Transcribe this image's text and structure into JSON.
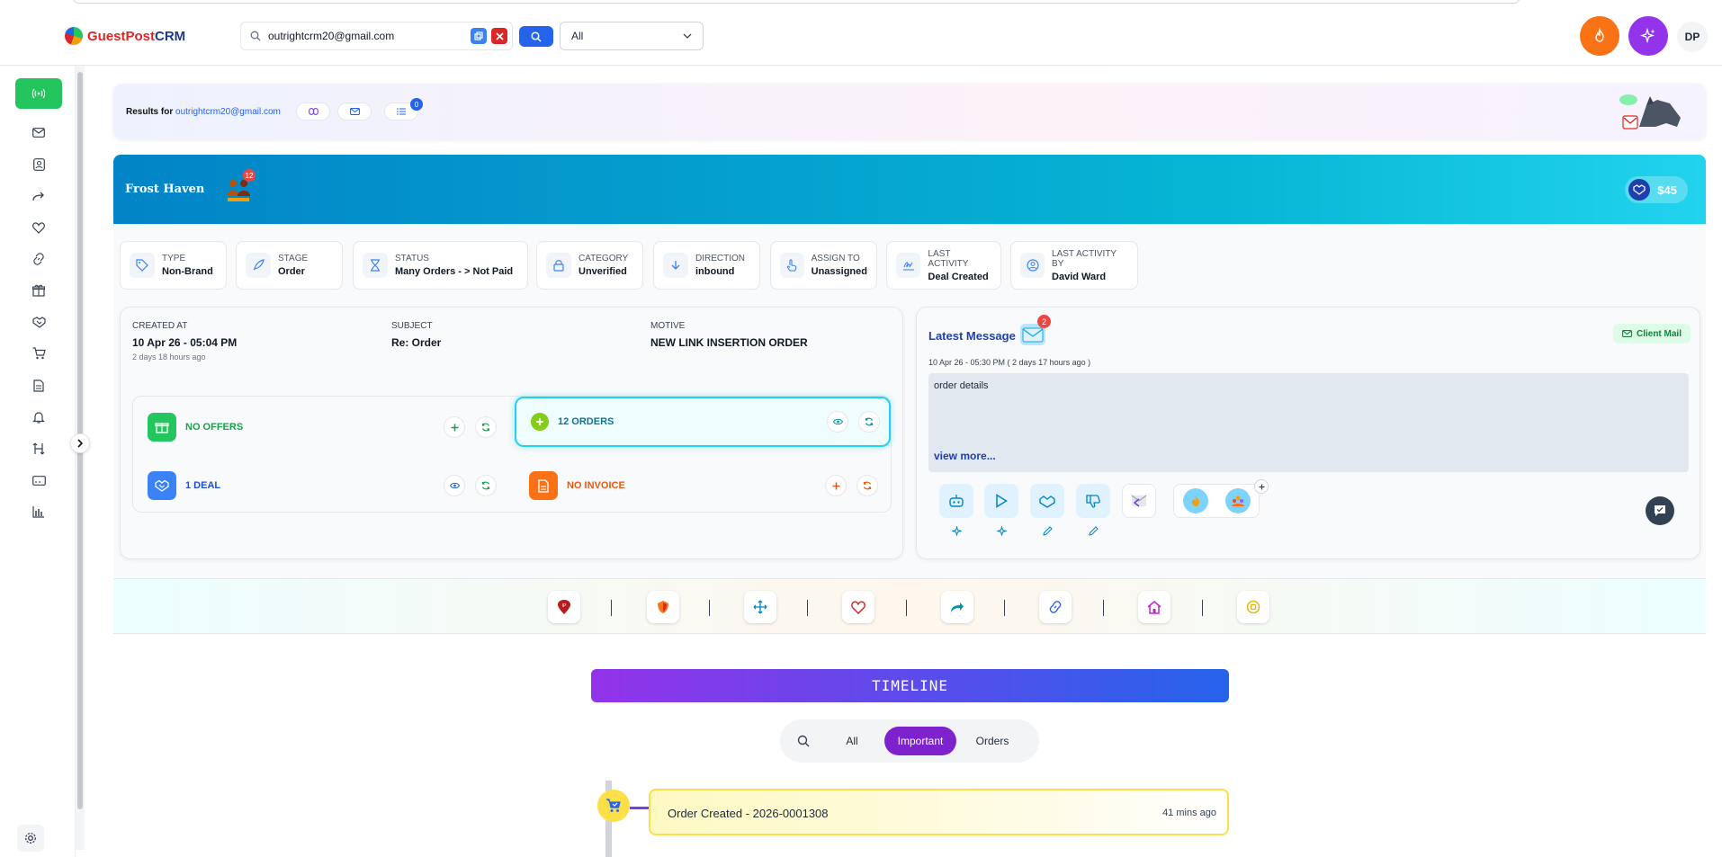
{
  "brand": {
    "part1": "GuestPost",
    "part2": "CRM"
  },
  "search": {
    "value": "outrightcrm20@gmail.com",
    "filter": "All"
  },
  "user": {
    "initials": "DP"
  },
  "results": {
    "prefix": "Results for",
    "email": "outrightcrm20@gmail.com",
    "list_badge": "0"
  },
  "deal": {
    "title": "Frost Haven",
    "people_count": "12",
    "amount": "$45"
  },
  "info": [
    {
      "key": "TYPE",
      "value": "Non-Brand",
      "icon": "tag-icon"
    },
    {
      "key": "STAGE",
      "value": "Order",
      "icon": "rocket-icon"
    },
    {
      "key": "STATUS",
      "value": "Many Orders - > Not Paid",
      "icon": "hourglass-icon"
    },
    {
      "key": "CATEGORY",
      "value": "Unverified",
      "icon": "lock-icon"
    },
    {
      "key": "DIRECTION",
      "value": "inbound",
      "icon": "arrow-down-icon"
    },
    {
      "key": "ASSIGN TO",
      "value": "Unassigned",
      "icon": "hand-pointer-icon"
    },
    {
      "key": "LAST ACTIVITY",
      "value": "Deal Created",
      "icon": "signature-icon"
    },
    {
      "key": "LAST ACTIVITY BY",
      "value": "David Ward",
      "icon": "user-circle-icon"
    }
  ],
  "detail": {
    "created_label": "CREATED AT",
    "created_value": "10 Apr 26 - 05:04 PM",
    "created_ago": "2 days 18 hours ago",
    "subject_label": "SUBJECT",
    "subject_value": "Re: Order",
    "motive_label": "MOTIVE",
    "motive_value": "NEW LINK INSERTION ORDER"
  },
  "tiles": {
    "offers": "NO OFFERS",
    "orders": "12 ORDERS",
    "deal": "1 DEAL",
    "invoice": "NO INVOICE"
  },
  "message": {
    "title": "Latest Message",
    "badge": "2",
    "client": "Client Mail",
    "time": "10 Apr 26 - 05:30 PM   ( 2 days 17 hours ago )",
    "body": "order details",
    "more": "view more..."
  },
  "timeline": {
    "title": "TIMELINE",
    "filters": [
      "All",
      "Important",
      "Orders"
    ],
    "event_title": "Order Created - 2026-0001308",
    "event_ago": "41 mins ago"
  },
  "colors": {
    "accent": "#2563eb",
    "green": "#22c55e",
    "orange": "#f97316",
    "purple": "#9333ea",
    "cyan": "#06b6d4"
  }
}
